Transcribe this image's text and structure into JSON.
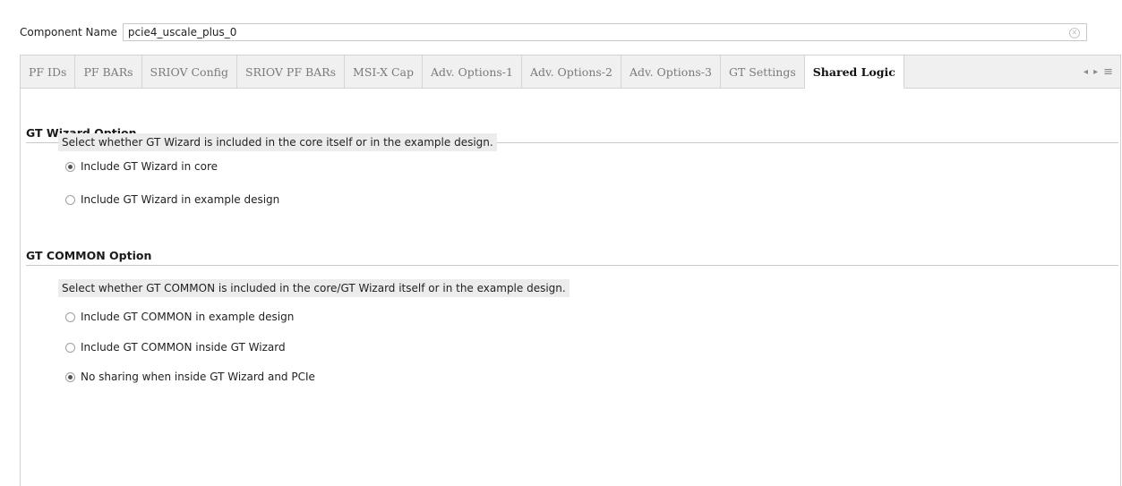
{
  "component": {
    "label": "Component Name",
    "value": "pcie4_uscale_plus_0"
  },
  "tabs": [
    {
      "label": "PF IDs",
      "active": false
    },
    {
      "label": "PF BARs",
      "active": false
    },
    {
      "label": "SRIOV Config",
      "active": false
    },
    {
      "label": "SRIOV PF BARs",
      "active": false
    },
    {
      "label": "MSI-X Cap",
      "active": false
    },
    {
      "label": "Adv. Options-1",
      "active": false
    },
    {
      "label": "Adv. Options-2",
      "active": false
    },
    {
      "label": "Adv. Options-3",
      "active": false
    },
    {
      "label": "GT Settings",
      "active": false
    },
    {
      "label": "Shared Logic",
      "active": true
    }
  ],
  "tab_controls": {
    "prev_icon": "◂",
    "next_icon": "▸",
    "menu_icon": "≡"
  },
  "gt_wizard": {
    "title": "GT Wizard Option",
    "description": "Select whether GT Wizard is included in the core itself or in the example design.",
    "options": [
      {
        "label": "Include GT Wizard in core",
        "checked": true
      },
      {
        "label": "Include GT Wizard in example design",
        "checked": false
      }
    ]
  },
  "gt_common": {
    "title": "GT COMMON Option",
    "description": "Select whether GT COMMON is included in the core/GT Wizard itself or in the example design.",
    "options": [
      {
        "label": "Include GT COMMON in example design",
        "checked": false
      },
      {
        "label": "Include GT COMMON inside GT Wizard",
        "checked": false
      },
      {
        "label": "No sharing when inside GT Wizard and PCIe",
        "checked": true
      }
    ]
  }
}
